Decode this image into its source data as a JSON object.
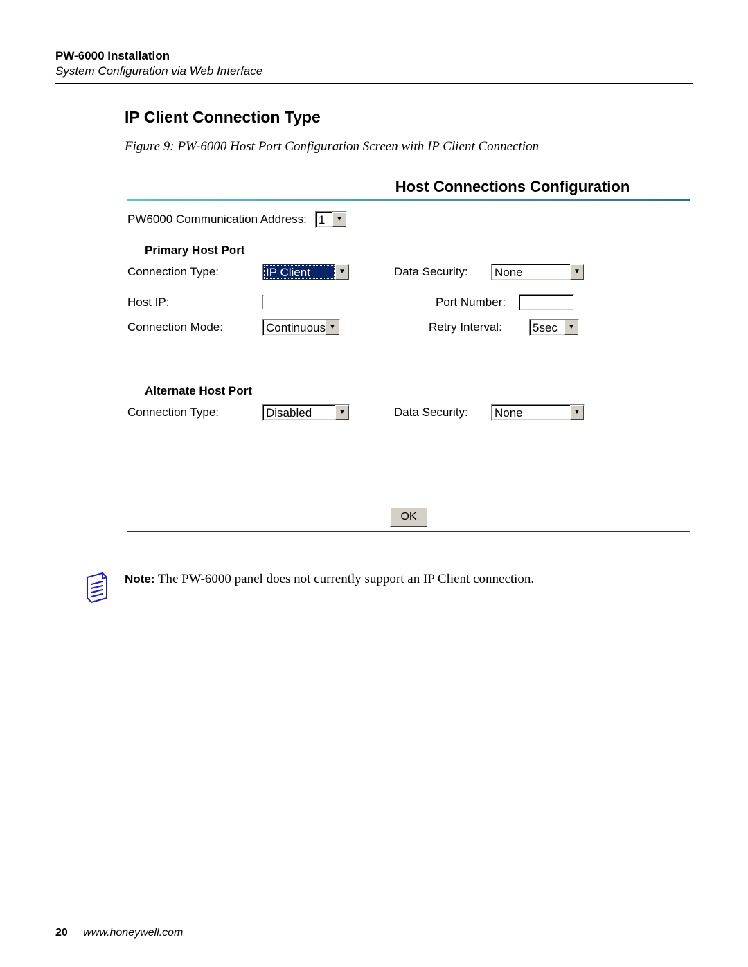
{
  "header": {
    "title": "PW-6000 Installation",
    "subtitle": "System Configuration via Web Interface"
  },
  "section_heading": "IP Client Connection Type",
  "figure_caption": "Figure 9:    PW-6000 Host Port Configuration Screen with IP Client Connection",
  "screenshot": {
    "title": "Host Connections Configuration",
    "comm_address_label": "PW6000 Communication Address:",
    "comm_address_value": "1",
    "primary_heading": "Primary Host Port",
    "primary": {
      "connection_type_label": "Connection Type:",
      "connection_type_value": "IP Client",
      "data_security_label": "Data Security:",
      "data_security_value": "None",
      "host_ip_label": "Host IP:",
      "host_ip_value": "",
      "port_number_label": "Port Number:",
      "port_number_value": "",
      "connection_mode_label": "Connection Mode:",
      "connection_mode_value": "Continuous",
      "retry_interval_label": "Retry Interval:",
      "retry_interval_value": "5sec"
    },
    "alternate_heading": "Alternate Host Port",
    "alternate": {
      "connection_type_label": "Connection Type:",
      "connection_type_value": "Disabled",
      "data_security_label": "Data Security:",
      "data_security_value": "None"
    },
    "ok_button": "OK"
  },
  "note": {
    "prefix": "Note:",
    "text": " The PW-6000 panel does not currently support an IP Client connection."
  },
  "footer": {
    "page_number": "20",
    "url": "www.honeywell.com"
  }
}
